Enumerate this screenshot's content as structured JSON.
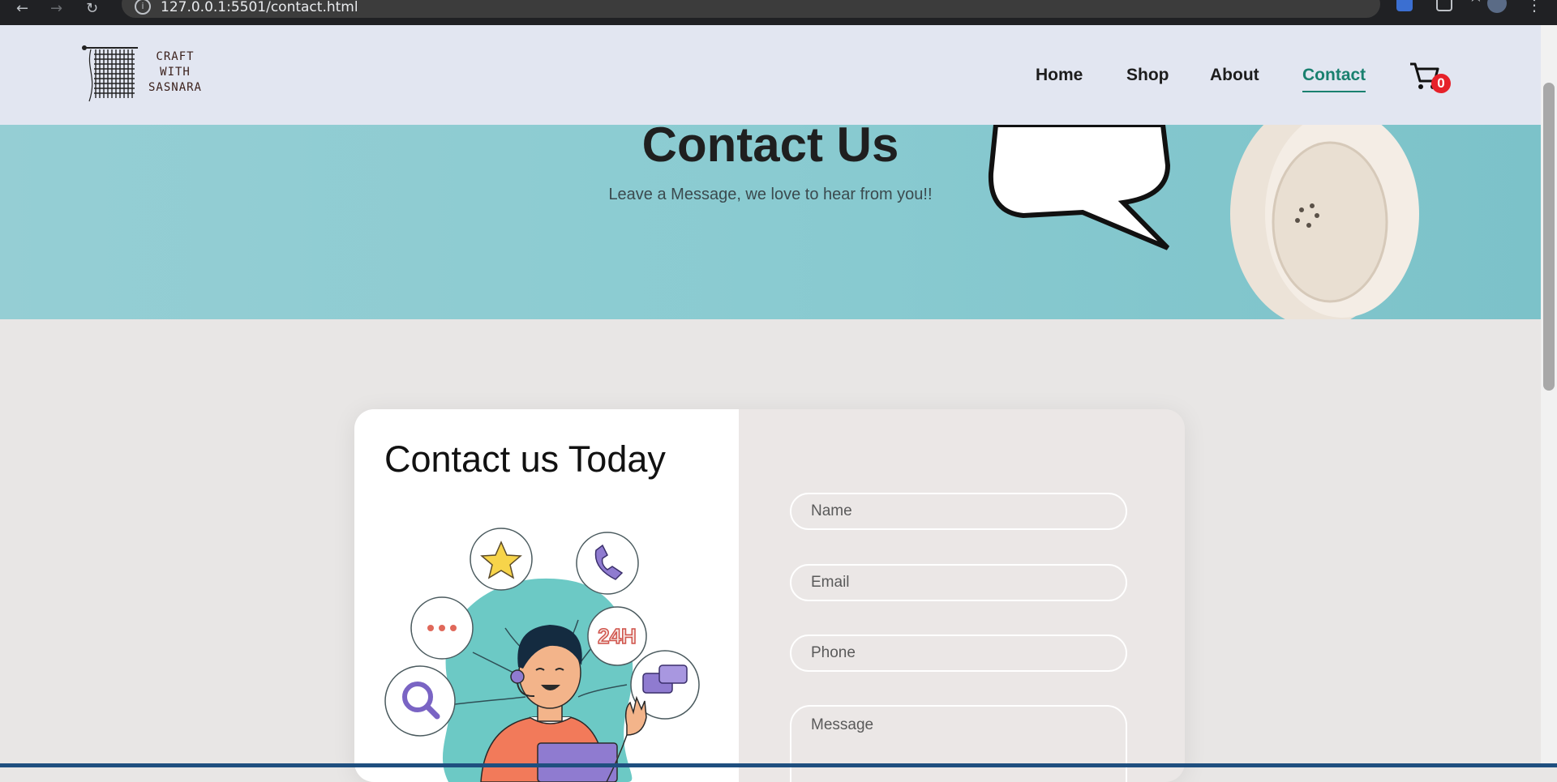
{
  "browser": {
    "url": "127.0.0.1:5501/contact.html",
    "back_icon": "arrow-left-icon",
    "forward_icon": "arrow-right-icon",
    "reload_icon": "reload-icon",
    "bookmark_icon": "star-icon"
  },
  "nav": {
    "logo_lines": [
      "CRAFT",
      "WITH",
      "SASNARA"
    ],
    "links": [
      {
        "label": "Home",
        "active": false
      },
      {
        "label": "Shop",
        "active": false
      },
      {
        "label": "About",
        "active": false
      },
      {
        "label": "Contact",
        "active": true
      }
    ],
    "cart_count": "0",
    "accent_color": "#19806f"
  },
  "hero": {
    "title": "Contact Us",
    "subtitle": "Leave a Message, we love to hear from you!!"
  },
  "contact": {
    "title": "Contact us Today",
    "illustration_badge": "24H",
    "fields": {
      "name_placeholder": "Name",
      "email_placeholder": "Email",
      "phone_placeholder": "Phone",
      "message_placeholder": "Message"
    }
  }
}
